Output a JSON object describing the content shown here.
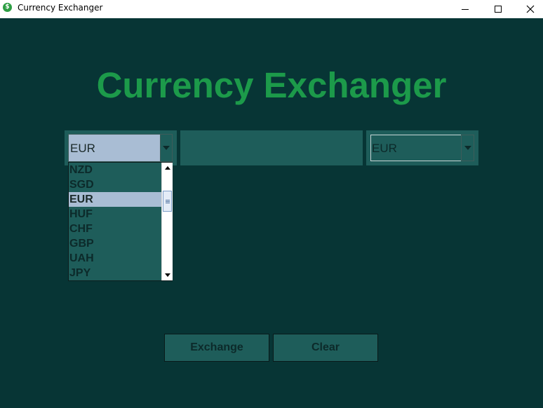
{
  "window": {
    "title": "Currency Exchanger",
    "icon": "dollar-coin-icon"
  },
  "heading": "Currency Exchanger",
  "from_currency": {
    "selected": "EUR",
    "options_visible": [
      "NZD",
      "SGD",
      "EUR",
      "HUF",
      "CHF",
      "GBP",
      "UAH",
      "JPY"
    ],
    "highlighted_index": 2
  },
  "amount": {
    "value": ""
  },
  "to_currency": {
    "selected": "EUR"
  },
  "buttons": {
    "exchange": "Exchange",
    "clear": "Clear"
  },
  "colors": {
    "background": "#073535",
    "field": "#1e5d5a",
    "heading": "#1c9a4a",
    "selection": "#a9bdd4"
  }
}
